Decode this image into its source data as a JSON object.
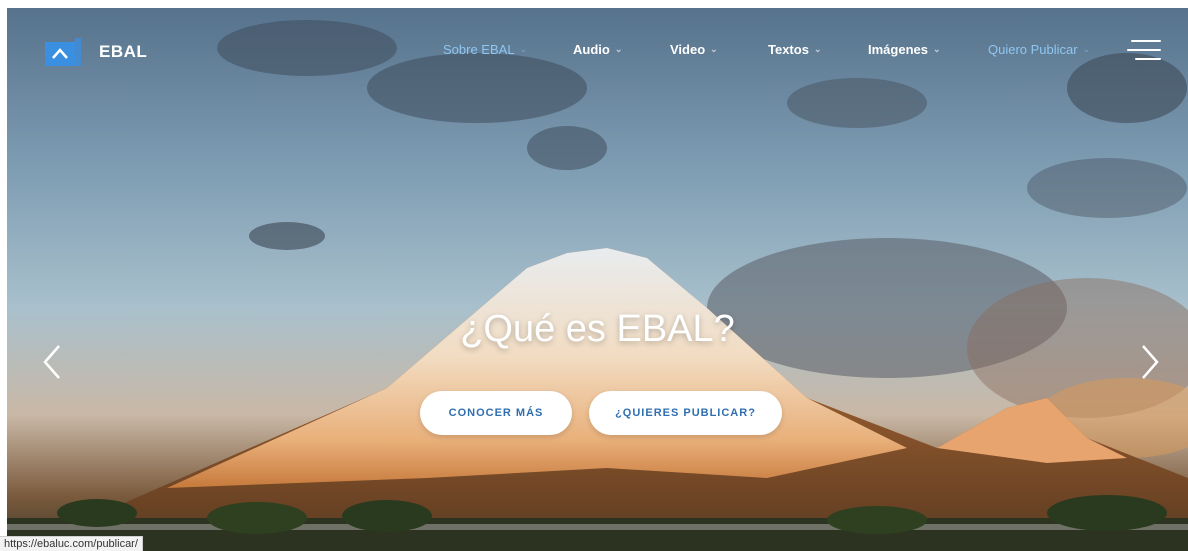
{
  "header": {
    "brand": "EBAL",
    "nav": [
      {
        "label": "Sobre EBAL",
        "active": true
      },
      {
        "label": "Audio",
        "active": false
      },
      {
        "label": "Video",
        "active": false
      },
      {
        "label": "Textos",
        "active": false
      },
      {
        "label": "Imágenes",
        "active": false
      },
      {
        "label": "Quiero Publicar",
        "active": true
      }
    ],
    "menu_icon": "hamburger-menu-icon"
  },
  "hero": {
    "title": "¿Qué es EBAL?",
    "primary_button": "CONOCER MÁS",
    "secondary_button": "¿QUIERES PUBLICAR?",
    "prev_icon": "chevron-left-icon",
    "next_icon": "chevron-right-icon"
  },
  "status_bar": {
    "url": "https://ebaluc.com/publicar/"
  },
  "colors": {
    "accent": "#2f6fb0",
    "nav_active": "#8fc6f0",
    "logo_blue": "#3b8fe0"
  }
}
